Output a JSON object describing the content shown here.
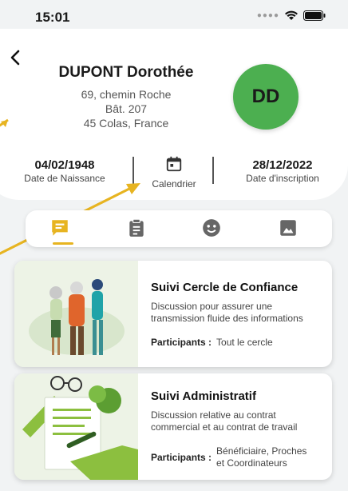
{
  "status_bar": {
    "time": "15:01"
  },
  "profile": {
    "name": "DUPONT Dorothée",
    "address_line1": "69, chemin Roche",
    "address_line2": "Bât. 207",
    "address_line3": "45 Colas, France",
    "initials": "DD"
  },
  "dates": {
    "birth_date": "04/02/1948",
    "birth_label": "Date de Naissance",
    "calendar_label": "Calendrier",
    "signup_date": "28/12/2022",
    "signup_label": "Date d'inscription"
  },
  "tabs": [
    {
      "icon": "chat-icon",
      "selected": true
    },
    {
      "icon": "clipboard-icon",
      "selected": false
    },
    {
      "icon": "face-icon",
      "selected": false
    },
    {
      "icon": "image-icon",
      "selected": false
    }
  ],
  "cards": [
    {
      "title": "Suivi Cercle de Confiance",
      "desc_line1": "Discussion pour assurer une",
      "desc_line2": "transmission fluide des informations",
      "participants_label": "Participants :",
      "participants_line1": "Tout le cercle",
      "participants_line2": ""
    },
    {
      "title": "Suivi Administratif",
      "desc_line1": "Discussion relative au contrat",
      "desc_line2": "commercial et au contrat de travail",
      "participants_label": "Participants :",
      "participants_line1": "Bénéficiaire, Proches",
      "participants_line2": "et Coordinateurs"
    }
  ],
  "colors": {
    "accent": "#e7b421",
    "avatar": "#4caf50",
    "background": "#f1f3f4"
  }
}
